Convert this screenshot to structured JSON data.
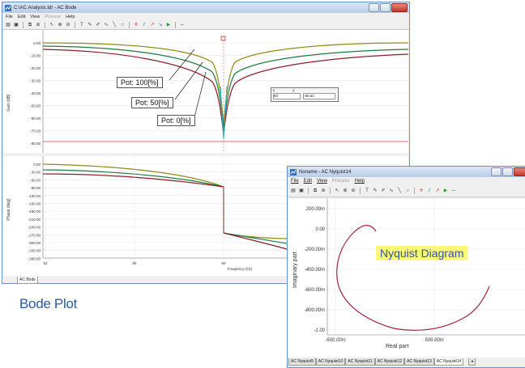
{
  "bode_window": {
    "title": "C:\\AC Analysis.tdr - AC Bode",
    "menu": [
      "File",
      "Edit",
      "View",
      "Process",
      "Help"
    ],
    "gain_axis_label": "Gain (dB)",
    "phase_axis_label": "Phase (deg)",
    "frequency_label": "Frequency (Hz)",
    "gain_ticks": [
      "0.00",
      "-10.00",
      "-20.00",
      "-30.00",
      "-40.00",
      "-50.00",
      "-60.00",
      "-70.00",
      "-80.00"
    ],
    "phase_ticks": [
      "0.00",
      "-30.00",
      "-60.00",
      "-90.00",
      "-120.00",
      "-150.00",
      "-180.00",
      "-210.00",
      "-240.00",
      "-270.00",
      "-300.00",
      "-330.00",
      "-360.00"
    ],
    "freq_ticks": [
      "52",
      "56",
      "60"
    ],
    "annotations": [
      "Pot: 100[%]",
      "Pot: 50[%]",
      "Pot: 0[%]"
    ],
    "cursor_box": {
      "x_label": "x",
      "y_label": "y",
      "x_value": "60",
      "y_value": "-88.52"
    },
    "tab": "AC Bode"
  },
  "nyquist_window": {
    "title": "Noname - AC Nyquist14",
    "menu": [
      "File",
      "Edit",
      "View",
      "Process",
      "Help"
    ],
    "diagram_label": "Nyquist Diagram",
    "y_axis_label": "Imaginary part",
    "x_axis_label": "Real part",
    "y_ticks": [
      "200.00m",
      "0.00",
      "-200.00m",
      "-400.00m",
      "-600.00m",
      "-800.00m",
      "-1.00"
    ],
    "x_ticks": [
      "-500.00m",
      "500.00m"
    ],
    "tabs": [
      "AC Nyquist9",
      "AC Nyquist10",
      "AC Nyquist11",
      "AC Nyquist12",
      "AC Nyquist13",
      "AC Nyquist14"
    ],
    "active_tab": "AC Nyquist14"
  },
  "captions": {
    "bode": "Bode Plot"
  },
  "colors": {
    "pot100": "#8f8a1a",
    "pot50": "#1f7a3e",
    "pot0": "#8b1e2a",
    "nyquist": "#a0283a",
    "caption": "#2c5a9e",
    "label_bg": "#fafa7a"
  }
}
